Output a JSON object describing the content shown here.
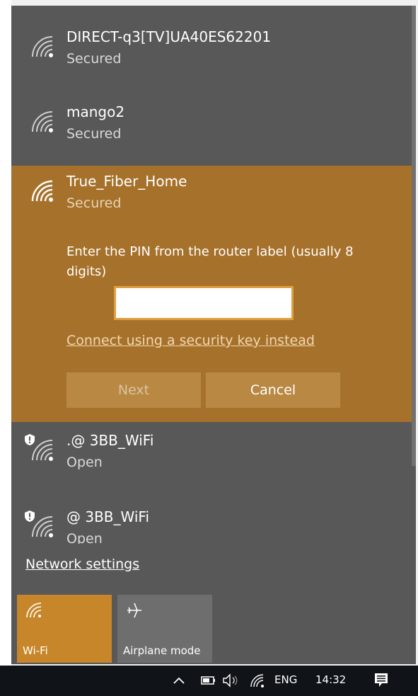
{
  "networks": [
    {
      "name": "DIRECT-q3[TV]UA40ES62201",
      "status": "Secured"
    },
    {
      "name": "mango2",
      "status": "Secured"
    },
    {
      "name": "True_Fiber_Home",
      "status": "Secured"
    },
    {
      "name": ".@  3BB_WiFi",
      "status": "Open"
    },
    {
      "name": "@ 3BB_WiFi",
      "status": "Open"
    }
  ],
  "connect_panel": {
    "prompt": "Enter the PIN from the router label (usually 8 digits)",
    "pin_value": "",
    "alt_link": "Connect using a security key instead",
    "next_label": "Next",
    "cancel_label": "Cancel"
  },
  "network_settings_label": "Network settings",
  "quick_actions": {
    "wifi_label": "Wi-Fi",
    "airplane_label": "Airplane mode"
  },
  "taskbar": {
    "language": "ENG",
    "time": "14:32"
  },
  "colors": {
    "flyout_bg": "#585858",
    "accent": "#c8862b",
    "expanded_bg": "#a6712b"
  },
  "icons": {
    "network": "wifi-icon",
    "open_shield": "shield-warning-icon",
    "airplane": "airplane-icon",
    "chevron": "chevron-up-icon",
    "battery": "battery-icon",
    "volume": "volume-icon",
    "notifications": "notifications-icon"
  }
}
